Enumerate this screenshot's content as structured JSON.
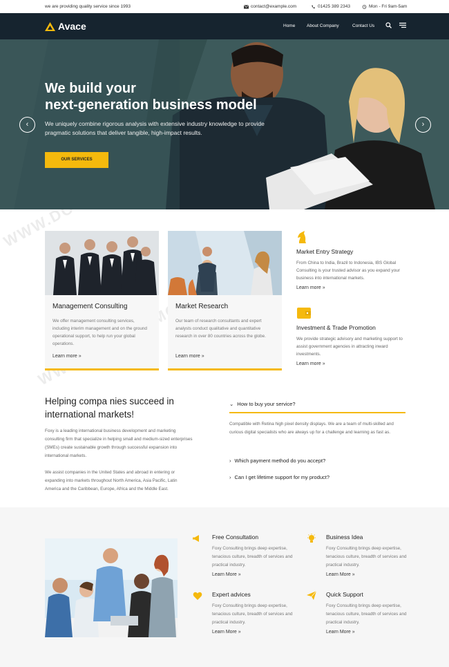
{
  "topbar": {
    "tagline": "we are providing quality service since 1993",
    "email": "contact@example.com",
    "phone": "01425 389 2343",
    "hours": "Mon - Fri 9am-5am"
  },
  "header": {
    "brand": "Avace",
    "nav": [
      "Home",
      "About Company",
      "Contact Us"
    ]
  },
  "hero": {
    "title_line1": "We build your",
    "title_line2": "next-generation business model",
    "subtitle": "We uniquely combine rigorous analysis with extensive industry knowledge to provide pragmatic solutions that deliver tangible, high-impact results.",
    "button": "OUR SERVICES",
    "prev": "‹",
    "next": "›"
  },
  "services": {
    "cards": [
      {
        "title": "Management Consulting",
        "text": "We offer management consulting services, including interim management and on the ground operational support, to help run your global operations.",
        "more": "Learn more"
      },
      {
        "title": "Market Research",
        "text": "Our team of research consultants and expert analysts conduct qualitative and quantitative research in over 80 countries across the globe.",
        "more": "Learn more"
      }
    ],
    "side": [
      {
        "title": "Market Entry Strategy",
        "text": "From China to India, Brazil to Indonesia, IBS Global Consulting is your trusted advisor as you expand your business into international markets.",
        "more": "Learn more"
      },
      {
        "title": "Investment & Trade Promotion",
        "text": "We provide strategic advisory and marketing support to assist government agencies in attracting inward investments.",
        "more": "Learn more"
      }
    ]
  },
  "about": {
    "heading": "Helping compa nies succeed in international markets!",
    "para1": "Foxy is a leading international business development and marketing consulting firm that specialize in helping small and medium-sized enterprises (SMEs) create sustainable growth through successful expansion into international markets.",
    "para2": "We assist companies in the United States and abroad in entering or expanding into markets throughout North America, Asia Pacific, Latin America and the Caribbean, Europe, Africa and the Middle East."
  },
  "faq": {
    "items": [
      {
        "q": "How to buy your service?",
        "a": "Compatible with Retina high pixel density displays. We are a team of multi-skilled and curious digital specialists who are always up for a challenge and learning as fast as."
      },
      {
        "q": "Which payment method do you accept?"
      },
      {
        "q": "Can I get lifetime support for my product?"
      }
    ]
  },
  "features": [
    {
      "title": "Free Consultation",
      "text": "Foxy Consulting brings deep expertise, tenacious culture, breadth of services and practical industry.",
      "more": "Learn More"
    },
    {
      "title": "Business Idea",
      "text": "Foxy Consulting brings deep expertise, tenacious culture, breadth of services and practical industry.",
      "more": "Learn More"
    },
    {
      "title": "Expert advices",
      "text": "Foxy Consulting brings deep expertise, tenacious culture, breadth of services and practical industry.",
      "more": "Learn More"
    },
    {
      "title": "Quick Support",
      "text": "Foxy Consulting brings deep expertise, tenacious culture, breadth of services and practical industry.",
      "more": "Learn More"
    }
  ],
  "watermark": "WWW.DOWNDEMO.COM",
  "colors": {
    "accent": "#f5b90d",
    "header": "#16242f"
  }
}
